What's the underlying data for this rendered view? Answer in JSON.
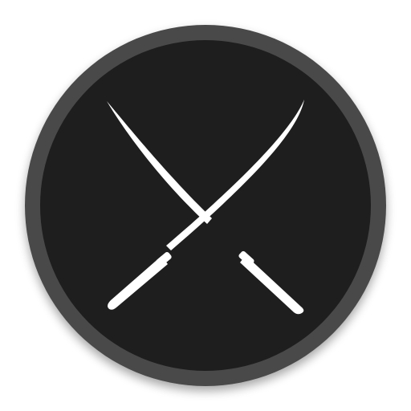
{
  "icon": {
    "name": "crossed-katanas-icon",
    "colors": {
      "background": "#ffffff",
      "ring": "#4a4a4a",
      "disc": "#1e1e1e",
      "blade": "#ffffff"
    }
  }
}
